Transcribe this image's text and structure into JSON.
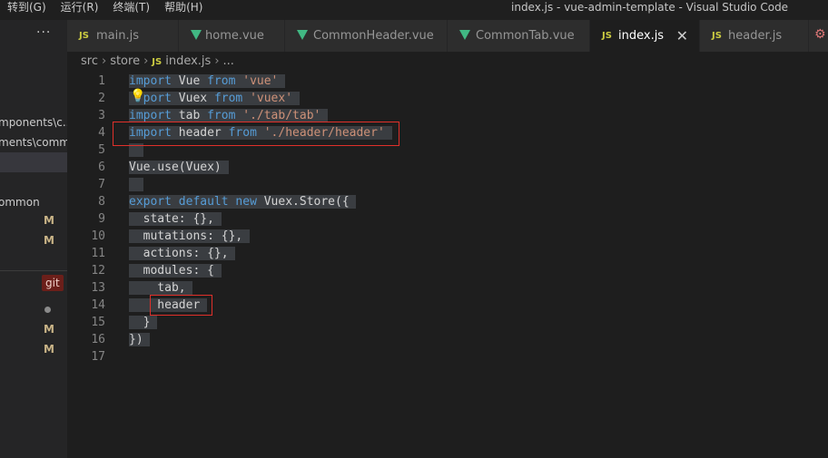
{
  "menu": [
    "转到(G)",
    "运行(R)",
    "终端(T)",
    "帮助(H)"
  ],
  "window_title": "index.js - vue-admin-template - Visual Studio Code",
  "sidebar": {
    "more": "···",
    "rows": [
      "mponents\\c...",
      "ments\\comm...",
      "",
      "ommon"
    ],
    "marks": [
      "M",
      "M",
      "M",
      "M"
    ],
    "git_badge": "git"
  },
  "tabs": [
    {
      "label": "main.js",
      "icon": "js-icon",
      "icon_text": "JS"
    },
    {
      "label": "home.vue",
      "icon": "vue-icon",
      "icon_text": ""
    },
    {
      "label": "CommonHeader.vue",
      "icon": "vue-icon",
      "icon_text": ""
    },
    {
      "label": "CommonTab.vue",
      "icon": "vue-icon",
      "icon_text": ""
    },
    {
      "label": "index.js",
      "icon": "js-icon",
      "icon_text": "JS",
      "active": true
    },
    {
      "label": "header.js",
      "icon": "js-icon",
      "icon_text": "JS"
    }
  ],
  "tab_close": "✕",
  "breadcrumb": {
    "parts": [
      "src",
      "store",
      "index.js",
      "..."
    ],
    "sep": "›",
    "js": "JS"
  },
  "code": {
    "line_numbers": [
      "1",
      "2",
      "3",
      "4",
      "5",
      "6",
      "7",
      "8",
      "9",
      "10",
      "11",
      "12",
      "13",
      "14",
      "15",
      "16",
      "17"
    ],
    "lines": [
      [
        [
          "kw",
          "import"
        ],
        [
          "id",
          " Vue "
        ],
        [
          "kw",
          "from"
        ],
        [
          "id",
          " "
        ],
        [
          "str",
          "'vue'"
        ]
      ],
      [
        [
          "kw",
          "  port"
        ],
        [
          "id",
          " Vuex "
        ],
        [
          "kw",
          "from"
        ],
        [
          "id",
          " "
        ],
        [
          "str",
          "'vuex'"
        ]
      ],
      [
        [
          "kw",
          "import"
        ],
        [
          "id",
          " tab "
        ],
        [
          "kw",
          "from"
        ],
        [
          "id",
          " "
        ],
        [
          "str",
          "'./tab/tab'"
        ]
      ],
      [
        [
          "kw",
          "import"
        ],
        [
          "id",
          " header "
        ],
        [
          "kw",
          "from"
        ],
        [
          "id",
          " "
        ],
        [
          "str",
          "'./header/header'"
        ]
      ],
      [],
      [
        [
          "id",
          "Vue.use(Vuex)"
        ]
      ],
      [],
      [
        [
          "kw",
          "export"
        ],
        [
          "id",
          " "
        ],
        [
          "kw",
          "default"
        ],
        [
          "id",
          " "
        ],
        [
          "kw",
          "new"
        ],
        [
          "id",
          " Vuex.Store({"
        ]
      ],
      [
        [
          "id",
          "  state: {},"
        ]
      ],
      [
        [
          "id",
          "  mutations: {},"
        ]
      ],
      [
        [
          "id",
          "  actions: {},"
        ]
      ],
      [
        [
          "id",
          "  modules: {"
        ]
      ],
      [
        [
          "id",
          "    tab,"
        ]
      ],
      [
        [
          "id",
          "    header"
        ]
      ],
      [
        [
          "id",
          "  }"
        ]
      ],
      [
        [
          "id",
          "})"
        ]
      ],
      []
    ]
  },
  "colors": {
    "keyword": "#569cd6",
    "string": "#ce9178",
    "annotation": "#e0302a"
  }
}
